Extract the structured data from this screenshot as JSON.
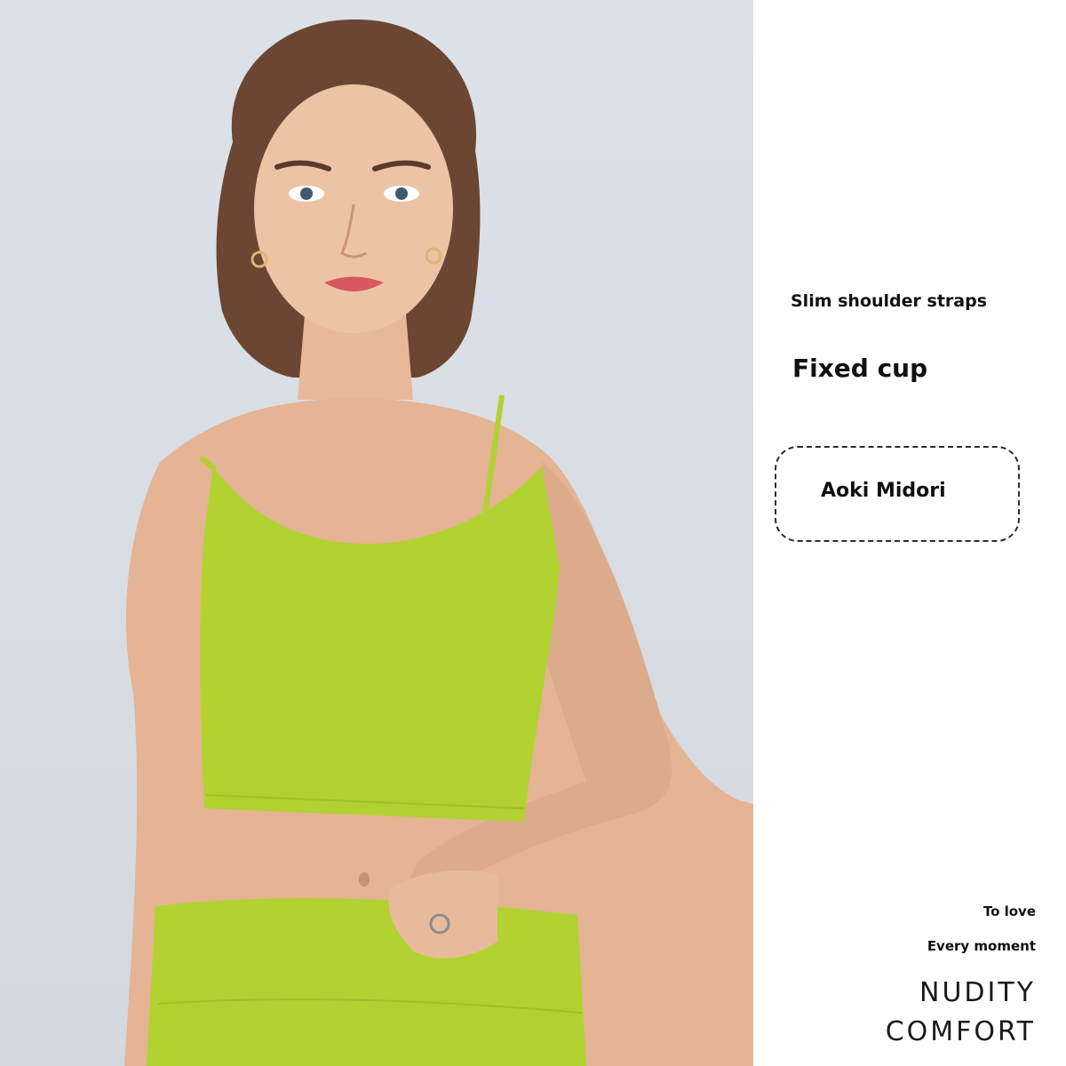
{
  "features": {
    "straps": "Slim shoulder straps",
    "cup": "Fixed cup"
  },
  "color_name": "Aoki Midori",
  "slogan": {
    "line1": "To love",
    "line2": "Every moment"
  },
  "tagline": {
    "line1": "NUDITY",
    "line2": "COMFORT"
  },
  "colors": {
    "garment": "#b2d231",
    "background": "#dcdfe6"
  }
}
